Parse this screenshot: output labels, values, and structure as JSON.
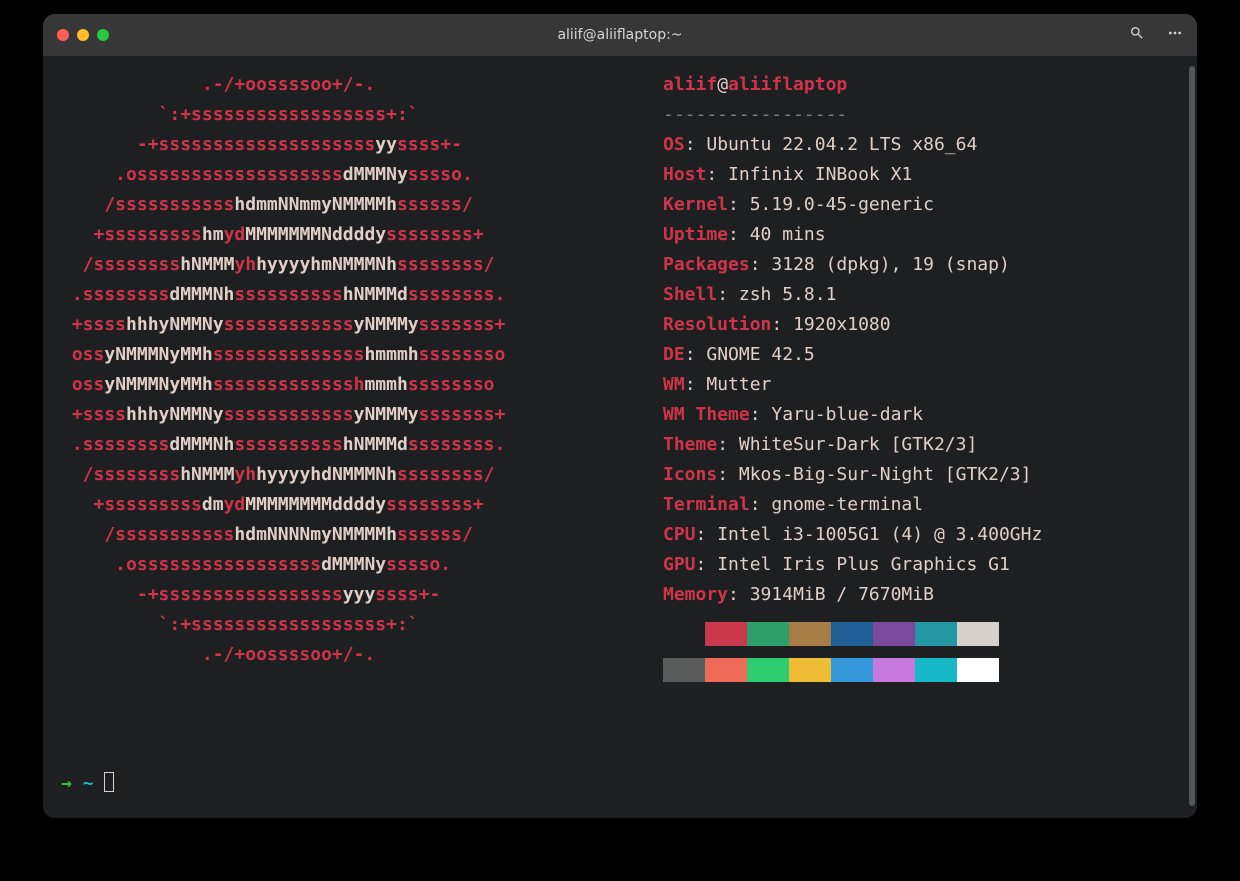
{
  "window": {
    "title": "aliif@aliiflaptop:~"
  },
  "neofetch": {
    "user": "aliif",
    "host": "aliiflaptop",
    "at": "@",
    "separator": "-----------------",
    "info": [
      {
        "label": "OS",
        "value": "Ubuntu 22.04.2 LTS x86_64"
      },
      {
        "label": "Host",
        "value": "Infinix INBook X1"
      },
      {
        "label": "Kernel",
        "value": "5.19.0-45-generic"
      },
      {
        "label": "Uptime",
        "value": "40 mins"
      },
      {
        "label": "Packages",
        "value": "3128 (dpkg), 19 (snap)"
      },
      {
        "label": "Shell",
        "value": "zsh 5.8.1"
      },
      {
        "label": "Resolution",
        "value": "1920x1080"
      },
      {
        "label": "DE",
        "value": "GNOME 42.5"
      },
      {
        "label": "WM",
        "value": "Mutter"
      },
      {
        "label": "WM Theme",
        "value": "Yaru-blue-dark"
      },
      {
        "label": "Theme",
        "value": "WhiteSur-Dark [GTK2/3]"
      },
      {
        "label": "Icons",
        "value": "Mkos-Big-Sur-Night [GTK2/3]"
      },
      {
        "label": "Terminal",
        "value": "gnome-terminal"
      },
      {
        "label": "CPU",
        "value": "Intel i3-1005G1 (4) @ 3.400GHz"
      },
      {
        "label": "GPU",
        "value": "Intel Iris Plus Graphics G1"
      },
      {
        "label": "Memory",
        "value": "3914MiB / 7670MiB"
      }
    ],
    "palette": {
      "row1": [
        "#1d1f21",
        "#c9384b",
        "#2d9f6a",
        "#a77c47",
        "#205e96",
        "#7a4a9c",
        "#2596a4",
        "#d6d1cb"
      ],
      "row2": [
        "#5a5c5c",
        "#f06a5a",
        "#2ecc71",
        "#eebd35",
        "#3498db",
        "#c678dd",
        "#17b8c8",
        "#ffffff"
      ]
    }
  },
  "prompt": {
    "arrow": "→",
    "tilde": "~"
  },
  "logo": [
    [
      [
        "             .-/+oossssoo+/-.",
        "red"
      ]
    ],
    [
      [
        "         `:+ssssssssssssssssss+:`",
        "red"
      ]
    ],
    [
      [
        "       -+ssssssssssssssssssss",
        "red"
      ],
      [
        "yy",
        "wht"
      ],
      [
        "ssss+-",
        "red"
      ]
    ],
    [
      [
        "     .osssssssssssssssssss",
        "red"
      ],
      [
        "dMMMNy",
        "wht"
      ],
      [
        "sssso.",
        "red"
      ]
    ],
    [
      [
        "    /sssssssssss",
        "red"
      ],
      [
        "hdmmNNmmyNMMMMh",
        "wht"
      ],
      [
        "ssssss/",
        "red"
      ]
    ],
    [
      [
        "   +sssssssss",
        "red"
      ],
      [
        "hm",
        "wht"
      ],
      [
        "yd",
        "red"
      ],
      [
        "MMMMMMMNddddy",
        "wht"
      ],
      [
        "ssssssss+",
        "red"
      ]
    ],
    [
      [
        "  /ssssssss",
        "red"
      ],
      [
        "hNMMM",
        "wht"
      ],
      [
        "yh",
        "red"
      ],
      [
        "hyyyyhmNMMMNh",
        "wht"
      ],
      [
        "ssssssss/",
        "red"
      ]
    ],
    [
      [
        " .ssssssss",
        "red"
      ],
      [
        "dMMMNh",
        "wht"
      ],
      [
        "ssssssssss",
        "red"
      ],
      [
        "hNMMMd",
        "wht"
      ],
      [
        "ssssssss.",
        "red"
      ]
    ],
    [
      [
        " +ssss",
        "red"
      ],
      [
        "hhhyNMMNy",
        "wht"
      ],
      [
        "ssssssssssss",
        "red"
      ],
      [
        "yNMMMy",
        "wht"
      ],
      [
        "sssssss+",
        "red"
      ]
    ],
    [
      [
        " oss",
        "red"
      ],
      [
        "yNMMMNyMMh",
        "wht"
      ],
      [
        "ssssssssssssss",
        "red"
      ],
      [
        "hmmmh",
        "wht"
      ],
      [
        "ssssssso",
        "red"
      ]
    ],
    [
      [
        " oss",
        "red"
      ],
      [
        "yNMMMNyMMh",
        "wht"
      ],
      [
        "sssssssssssssh",
        "red"
      ],
      [
        "mmmh",
        "wht"
      ],
      [
        "ssssssso",
        "red"
      ]
    ],
    [
      [
        " +ssss",
        "red"
      ],
      [
        "hhhyNMMNy",
        "wht"
      ],
      [
        "ssssssssssss",
        "red"
      ],
      [
        "yNMMMy",
        "wht"
      ],
      [
        "sssssss+",
        "red"
      ]
    ],
    [
      [
        " .ssssssss",
        "red"
      ],
      [
        "dMMMNh",
        "wht"
      ],
      [
        "ssssssssss",
        "red"
      ],
      [
        "hNMMMd",
        "wht"
      ],
      [
        "ssssssss.",
        "red"
      ]
    ],
    [
      [
        "  /ssssssss",
        "red"
      ],
      [
        "hNMMM",
        "wht"
      ],
      [
        "yh",
        "red"
      ],
      [
        "hyyyyhdNMMMNh",
        "wht"
      ],
      [
        "ssssssss/",
        "red"
      ]
    ],
    [
      [
        "   +sssssssss",
        "red"
      ],
      [
        "dm",
        "wht"
      ],
      [
        "yd",
        "red"
      ],
      [
        "MMMMMMMMddddy",
        "wht"
      ],
      [
        "ssssssss+",
        "red"
      ]
    ],
    [
      [
        "    /sssssssssss",
        "red"
      ],
      [
        "hdmNNNNmyNMMMMh",
        "wht"
      ],
      [
        "ssssss/",
        "red"
      ]
    ],
    [
      [
        "     .osssssssssssssssss",
        "red"
      ],
      [
        "dMMMNy",
        "wht"
      ],
      [
        "sssso.",
        "red"
      ]
    ],
    [
      [
        "       -+sssssssssssssssss",
        "red"
      ],
      [
        "yyy",
        "wht"
      ],
      [
        "ssss+-",
        "red"
      ]
    ],
    [
      [
        "         `:+ssssssssssssssssss+:`",
        "red"
      ]
    ],
    [
      [
        "             .-/+oossssoo+/-.",
        "red"
      ]
    ]
  ]
}
